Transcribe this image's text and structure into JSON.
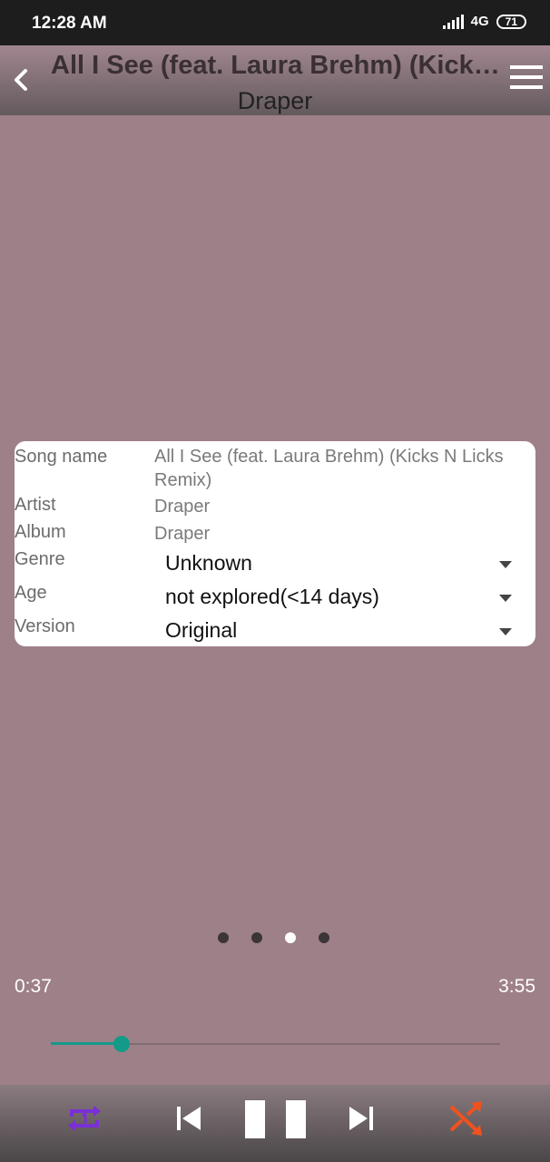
{
  "status": {
    "time": "12:28 AM",
    "network": "4G",
    "battery": "71"
  },
  "header": {
    "title": "All I See (feat. Laura Brehm) (Kick…",
    "subtitle": "Draper"
  },
  "info": {
    "song_label": "Song name",
    "song_value": "All I See (feat. Laura Brehm) (Kicks N Licks Remix)",
    "artist_label": "Artist",
    "artist_value": "Draper",
    "album_label": "Album",
    "album_value": "Draper",
    "genre_label": "Genre",
    "genre_value": "Unknown",
    "age_label": "Age",
    "age_value": "not explored(<14 days)",
    "version_label": "Version",
    "version_value": "Original"
  },
  "pager": {
    "count": 4,
    "active_index": 2
  },
  "player": {
    "current_time": "0:37",
    "total_time": "3:55",
    "progress_fraction": 0.157,
    "repeat_mode": "repeat-one",
    "shuffle": true
  },
  "colors": {
    "background": "#9e8088",
    "accent": "#139a88",
    "repeat_icon": "#7b2fd6",
    "shuffle_icon": "#f0521e"
  },
  "icons": [
    "back-arrow-icon",
    "menu-icon",
    "caret-down-icon",
    "repeat-one-icon",
    "previous-icon",
    "pause-icon",
    "next-icon",
    "shuffle-icon"
  ]
}
